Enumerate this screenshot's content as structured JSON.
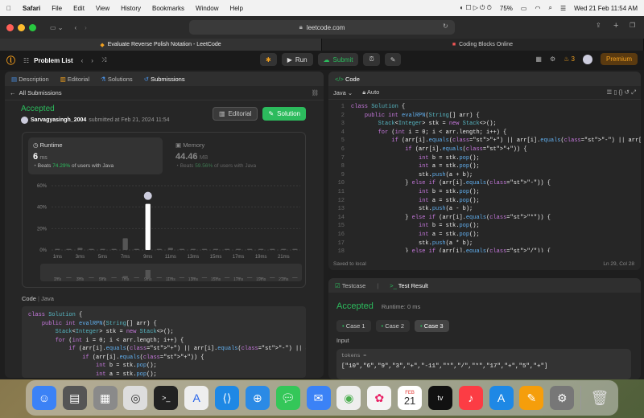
{
  "menubar": {
    "app": "Safari",
    "items": [
      "File",
      "Edit",
      "View",
      "History",
      "Bookmarks",
      "Window",
      "Help"
    ],
    "battery": "75%",
    "datetime": "Wed 21 Feb  11:54 AM"
  },
  "browser": {
    "url": "leetcode.com",
    "tabs": [
      "Evaluate Reverse Polish Notation - LeetCode",
      "Coding Blocks Online"
    ]
  },
  "lc": {
    "problem_list": "Problem List",
    "run": "Run",
    "submit": "Submit",
    "streak": "3",
    "premium": "Premium"
  },
  "left": {
    "tabs": [
      "Description",
      "Editorial",
      "Solutions",
      "Submissions"
    ],
    "all_submissions": "All Submissions",
    "status": "Accepted",
    "user": "Sarvagyasingh_2004",
    "submitted": "submitted at Feb 21, 2024 11:54",
    "editorial_btn": "Editorial",
    "solution_btn": "Solution",
    "runtime_label": "Runtime",
    "runtime_value": "6",
    "runtime_unit": "ms",
    "runtime_beats": "Beats",
    "runtime_pct": "74.29%",
    "runtime_of": "of users with Java",
    "memory_label": "Memory",
    "memory_value": "44.46",
    "memory_unit": "MB",
    "memory_beats": "Beats",
    "memory_pct": "59.56%",
    "memory_of": "of users with Java",
    "code_label": "Code",
    "code_lang": "Java"
  },
  "chart_data": {
    "type": "bar",
    "categories": [
      "1ms",
      "",
      "3ms",
      "",
      "5ms",
      "",
      "7ms",
      "",
      "9ms",
      "",
      "11ms",
      "",
      "13ms",
      "",
      "15ms",
      "",
      "17ms",
      "",
      "19ms",
      "",
      "21ms",
      ""
    ],
    "values": [
      1,
      1,
      2,
      1,
      1,
      1,
      11,
      1,
      43,
      1,
      2,
      1,
      1,
      1,
      1,
      1,
      1,
      1,
      1,
      1,
      1,
      1
    ],
    "highlight_index": 8,
    "yticks": [
      "60%",
      "40%",
      "20%",
      "0%"
    ],
    "ylim": [
      0,
      60
    ]
  },
  "left_code": [
    "class Solution {",
    "    public int evalRPN(String[] arr) {",
    "        Stack<Integer> stk = new Stack<>();",
    "        for (int i = 0; i < arr.length; i++) {",
    "            if (arr[i].equals(\"+\") || arr[i].equals(\"-\") || arr[i].equals(\"*\") ||",
    "                if (arr[i].equals(\"+\")) {",
    "                    int b = stk.pop();",
    "                    int a = stk.pop();"
  ],
  "right": {
    "code_tab": "Code",
    "lang": "Java",
    "mode": "Auto",
    "saved": "Saved to local",
    "position": "Ln 29, Col 28",
    "line_numbers": [
      "1",
      "2",
      "3",
      "4",
      "5",
      "6",
      "7",
      "8",
      "9",
      "10",
      "11",
      "12",
      "13",
      "14",
      "15",
      "16",
      "17",
      "18"
    ],
    "code": [
      "class Solution {",
      "    public int evalRPN(String[] arr) {",
      "        Stack<Integer> stk = new Stack<>();",
      "        for (int i = 0; i < arr.length; i++) {",
      "            if (arr[i].equals(\"+\") || arr[i].equals(\"-\") || arr[i].equals(\"*\") || arr[",
      "                if (arr[i].equals(\"+\")) {",
      "                    int b = stk.pop();",
      "                    int a = stk.pop();",
      "                    stk.push(a + b);",
      "                } else if (arr[i].equals(\"-\")) {",
      "                    int b = stk.pop();",
      "                    int a = stk.pop();",
      "                    stk.push(a - b);",
      "                } else if (arr[i].equals(\"*\")) {",
      "                    int b = stk.pop();",
      "                    int a = stk.pop();",
      "                    stk.push(a * b);",
      "                } else if (arr[i].equals(\"/\")) {"
    ],
    "testcase_tab": "Testcase",
    "result_tab": "Test Result",
    "result": "Accepted",
    "runtime": "Runtime: 0 ms",
    "cases": [
      "Case 1",
      "Case 2",
      "Case 3"
    ],
    "input_label": "Input",
    "var_name": "tokens =",
    "var_value": "[\"10\",\"6\",\"9\",\"3\",\"+\",\"-11\",\"*\",\"/\",\"*\",\"17\",\"+\",\"5\",\"+\"]"
  },
  "dock": {
    "calendar_month": "FEB",
    "calendar_day": "21"
  }
}
